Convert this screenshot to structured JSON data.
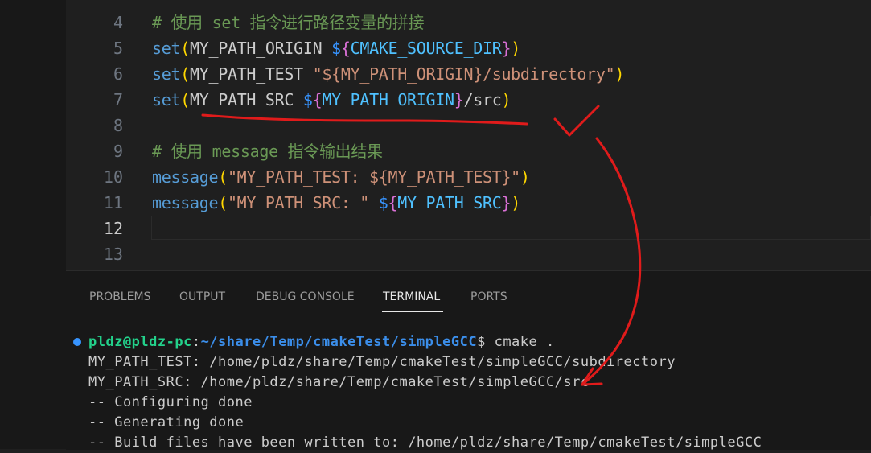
{
  "editor": {
    "lines": [
      {
        "num": "4",
        "tokens": [
          {
            "t": "# 使用 set 指令进行路径变量的拼接",
            "c": "cm"
          }
        ]
      },
      {
        "num": "5",
        "tokens": [
          {
            "t": "set",
            "c": "kw"
          },
          {
            "t": "(",
            "c": "br"
          },
          {
            "t": "MY_PATH_ORIGIN ",
            "c": "txt"
          },
          {
            "t": "$",
            "c": "dol"
          },
          {
            "t": "{",
            "c": "br2"
          },
          {
            "t": "CMAKE_SOURCE_DIR",
            "c": "var"
          },
          {
            "t": "}",
            "c": "br2"
          },
          {
            "t": ")",
            "c": "br"
          }
        ]
      },
      {
        "num": "6",
        "tokens": [
          {
            "t": "set",
            "c": "kw"
          },
          {
            "t": "(",
            "c": "br"
          },
          {
            "t": "MY_PATH_TEST ",
            "c": "txt"
          },
          {
            "t": "\"${MY_PATH_ORIGIN}/subdirectory\"",
            "c": "str"
          },
          {
            "t": ")",
            "c": "br"
          }
        ]
      },
      {
        "num": "7",
        "tokens": [
          {
            "t": "set",
            "c": "kw"
          },
          {
            "t": "(",
            "c": "br"
          },
          {
            "t": "MY_PATH_SRC ",
            "c": "txt"
          },
          {
            "t": "$",
            "c": "dol"
          },
          {
            "t": "{",
            "c": "br2"
          },
          {
            "t": "MY_PATH_ORIGIN",
            "c": "var"
          },
          {
            "t": "}",
            "c": "br2"
          },
          {
            "t": "/src",
            "c": "txt"
          },
          {
            "t": ")",
            "c": "br"
          }
        ]
      },
      {
        "num": "8",
        "tokens": []
      },
      {
        "num": "9",
        "tokens": [
          {
            "t": "# 使用 message 指令输出结果",
            "c": "cm"
          }
        ]
      },
      {
        "num": "10",
        "tokens": [
          {
            "t": "message",
            "c": "kw"
          },
          {
            "t": "(",
            "c": "br"
          },
          {
            "t": "\"MY_PATH_TEST: ${MY_PATH_TEST}\"",
            "c": "str"
          },
          {
            "t": ")",
            "c": "br"
          }
        ]
      },
      {
        "num": "11",
        "tokens": [
          {
            "t": "message",
            "c": "kw"
          },
          {
            "t": "(",
            "c": "br"
          },
          {
            "t": "\"MY_PATH_SRC: \" ",
            "c": "str"
          },
          {
            "t": "$",
            "c": "dol"
          },
          {
            "t": "{",
            "c": "br2"
          },
          {
            "t": "MY_PATH_SRC",
            "c": "var"
          },
          {
            "t": "}",
            "c": "br2"
          },
          {
            "t": ")",
            "c": "br"
          }
        ]
      },
      {
        "num": "12",
        "tokens": [],
        "active": true
      },
      {
        "num": "13",
        "tokens": []
      }
    ]
  },
  "panel": {
    "tabs": [
      {
        "label": "PROBLEMS",
        "active": false
      },
      {
        "label": "OUTPUT",
        "active": false
      },
      {
        "label": "DEBUG CONSOLE",
        "active": false
      },
      {
        "label": "TERMINAL",
        "active": true
      },
      {
        "label": "PORTS",
        "active": false
      }
    ],
    "terminal": {
      "prompt_user": "pldz@pldz-pc",
      "prompt_sep": ":",
      "prompt_path": "~/share/Temp/cmakeTest/simpleGCC",
      "prompt_symbol": "$",
      "command": " cmake .",
      "output": [
        "MY_PATH_TEST: /home/pldz/share/Temp/cmakeTest/simpleGCC/subdirectory",
        "MY_PATH_SRC: /home/pldz/share/Temp/cmakeTest/simpleGCC/src",
        "-- Configuring done",
        "-- Generating done",
        "-- Build files have been written to: /home/pldz/share/Temp/cmakeTest/simpleGCC"
      ]
    }
  },
  "colors": {
    "annotation_red": "#e01b1b",
    "status_dot": "#3794ff"
  }
}
